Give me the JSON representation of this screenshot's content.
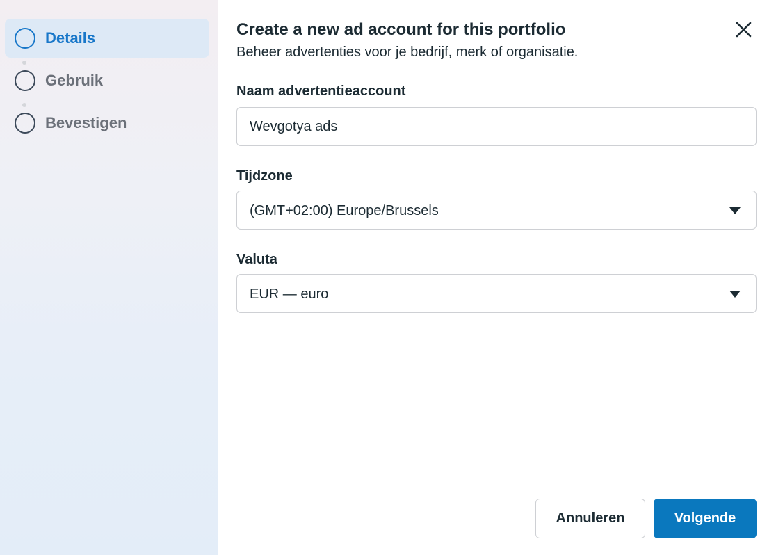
{
  "steps": [
    {
      "label": "Details",
      "active": true
    },
    {
      "label": "Gebruik",
      "active": false
    },
    {
      "label": "Bevestigen",
      "active": false
    }
  ],
  "dialog": {
    "title": "Create a new ad account for this portfolio",
    "subtitle": "Beheer advertenties voor je bedrijf, merk of organisatie.",
    "close_icon": "close-icon"
  },
  "fields": {
    "account_name": {
      "label": "Naam advertentieaccount",
      "value": "Wevgotya ads"
    },
    "timezone": {
      "label": "Tijdzone",
      "value": "(GMT+02:00) Europe/Brussels"
    },
    "currency": {
      "label": "Valuta",
      "value": "EUR — euro"
    }
  },
  "buttons": {
    "cancel": "Annuleren",
    "next": "Volgende"
  },
  "colors": {
    "accent": "#1877c9",
    "primary_button": "#0a78be",
    "text": "#1c2b33"
  }
}
